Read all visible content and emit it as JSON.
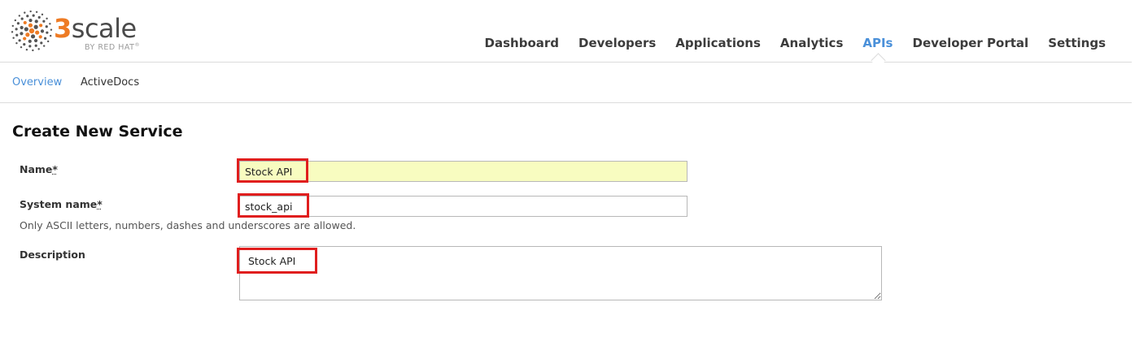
{
  "brand": {
    "name_prefix": "3",
    "name_suffix": "scale",
    "tagline": "BY RED HAT",
    "tagline_mark": "®",
    "colors": {
      "accent": "#ee7b24",
      "dots": "#555555"
    }
  },
  "main_nav": {
    "items": [
      {
        "label": "Dashboard",
        "active": false
      },
      {
        "label": "Developers",
        "active": false
      },
      {
        "label": "Applications",
        "active": false
      },
      {
        "label": "Analytics",
        "active": false
      },
      {
        "label": "APIs",
        "active": true
      },
      {
        "label": "Developer Portal",
        "active": false
      },
      {
        "label": "Settings",
        "active": false
      }
    ],
    "active_color": "#4a90d9"
  },
  "sub_nav": {
    "items": [
      {
        "label": "Overview",
        "active": true
      },
      {
        "label": "ActiveDocs",
        "active": false
      }
    ]
  },
  "form": {
    "title": "Create New Service",
    "name": {
      "label": "Name",
      "required_mark": "*",
      "value": "Stock API"
    },
    "system_name": {
      "label": "System name",
      "required_mark": "*",
      "value": "stock_api",
      "hint": "Only ASCII letters, numbers, dashes and underscores are allowed."
    },
    "description": {
      "label": "Description",
      "value": "Stock API"
    }
  },
  "annotation_color": "#e01e1e"
}
